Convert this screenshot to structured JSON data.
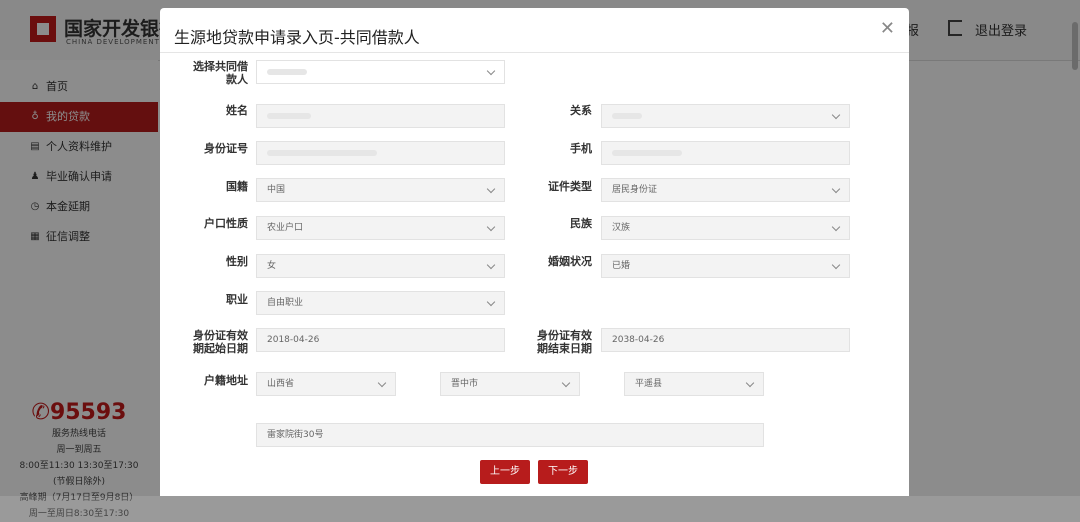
{
  "header": {
    "logo_cn": "国家开发银行",
    "logo_en": "CHINA DEVELOPMENT BANK",
    "nav_right": "报",
    "logout": "退出登录"
  },
  "sidebar": {
    "items": [
      {
        "label": "首页",
        "icon": "home-icon"
      },
      {
        "label": "我的贷款",
        "icon": "loan-icon"
      },
      {
        "label": "个人资料维护",
        "icon": "card-icon"
      },
      {
        "label": "毕业确认申请",
        "icon": "graduate-icon"
      },
      {
        "label": "本金延期",
        "icon": "clock-icon"
      },
      {
        "label": "征信调整",
        "icon": "doc-icon"
      }
    ],
    "phone": "95593",
    "hotline_lines": [
      "服务热线电话",
      "周一到周五",
      "8:00至11:30 13:30至17:30",
      "(节假日除外)",
      "高峰期（7月17日至9月8日）",
      "周一至周日8:30至17:30"
    ]
  },
  "modal": {
    "title": "生源地贷款申请录入页-共同借款人",
    "labels": {
      "co_borrower": "选择共同借款人",
      "name": "姓名",
      "relation": "关系",
      "id_no": "身份证号",
      "mobile": "手机",
      "nationality": "国籍",
      "id_type": "证件类型",
      "hukou_type": "户口性质",
      "ethnicity": "民族",
      "gender": "性别",
      "marital": "婚姻状况",
      "occupation": "职业",
      "id_start": "身份证有效期起始日期",
      "id_end": "身份证有效期结束日期",
      "address": "户籍地址"
    },
    "values": {
      "nationality": "中国",
      "id_type": "居民身份证",
      "hukou_type": "农业户口",
      "ethnicity": "汉族",
      "gender": "女",
      "marital": "已婚",
      "occupation": "自由职业",
      "id_start": "2018-04-26",
      "id_end": "2038-04-26",
      "province": "山西省",
      "city": "晋中市",
      "county": "平遥县",
      "street": "雷家院街30号"
    },
    "buttons": {
      "prev": "上一步",
      "next": "下一步"
    }
  }
}
